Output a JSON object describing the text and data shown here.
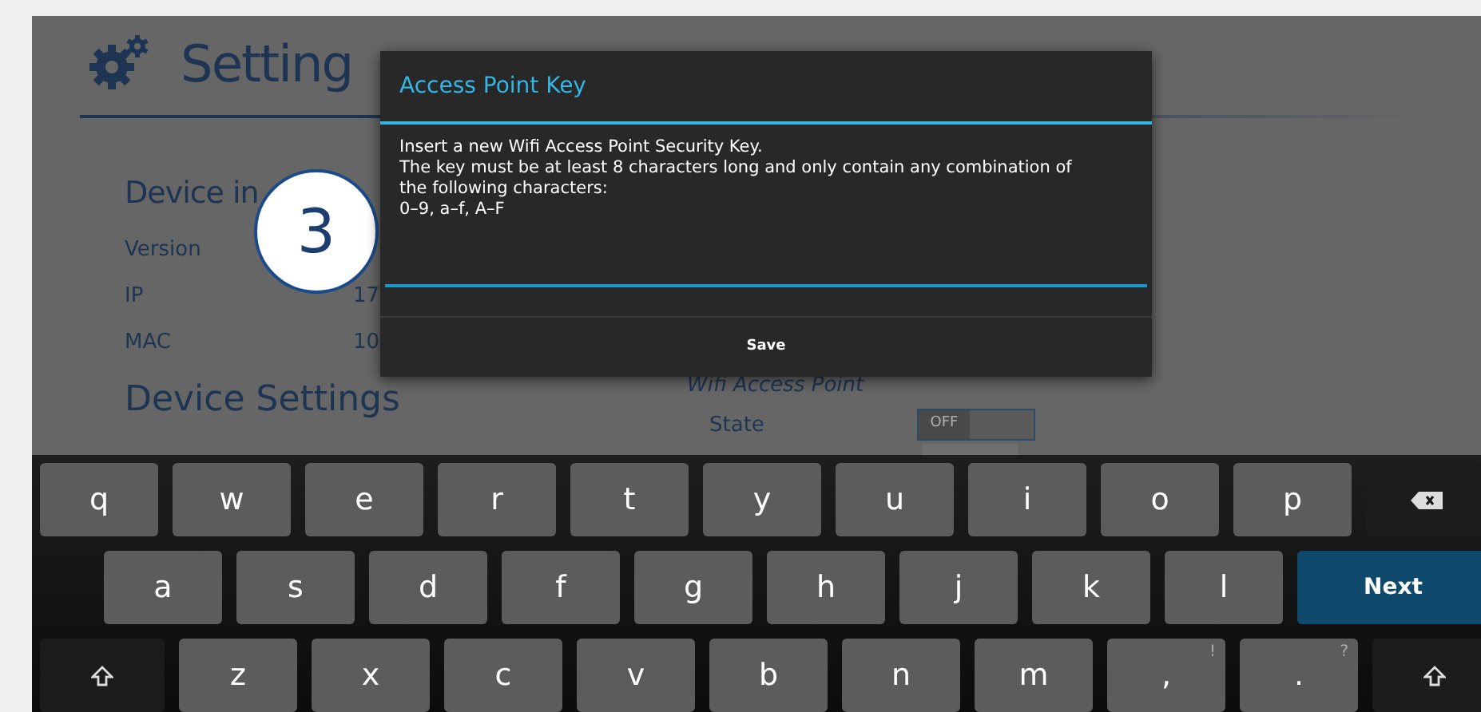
{
  "page": {
    "title": "Setting",
    "info_heading": "Device in",
    "info_rows": [
      {
        "label": "Version"
      },
      {
        "label": "IP",
        "value": "17"
      },
      {
        "label": "MAC",
        "value": "10"
      }
    ],
    "settings_heading": "Device Settings",
    "wifi_heading": "Wifi Access Point",
    "state_label": "State",
    "state_toggle": {
      "label": "OFF",
      "on": false
    }
  },
  "callout": "3",
  "dialog": {
    "title": "Access Point Key",
    "lines": [
      "Insert a new Wifi Access Point Security Key.",
      "The key must be at least 8 characters long and only contain any combination of",
      "the following characters:",
      "0–9, a–f, A–F"
    ],
    "button": "Save"
  },
  "keyboard": {
    "rows": [
      [
        {
          "kind": "char",
          "label": "q"
        },
        {
          "kind": "char",
          "label": "w"
        },
        {
          "kind": "char",
          "label": "e"
        },
        {
          "kind": "char",
          "label": "r"
        },
        {
          "kind": "char",
          "label": "t"
        },
        {
          "kind": "char",
          "label": "y"
        },
        {
          "kind": "char",
          "label": "u"
        },
        {
          "kind": "char",
          "label": "i"
        },
        {
          "kind": "char",
          "label": "o"
        },
        {
          "kind": "char",
          "label": "p"
        },
        {
          "kind": "backspace"
        }
      ],
      [
        {
          "kind": "char",
          "label": "a"
        },
        {
          "kind": "char",
          "label": "s"
        },
        {
          "kind": "char",
          "label": "d"
        },
        {
          "kind": "char",
          "label": "f"
        },
        {
          "kind": "char",
          "label": "g"
        },
        {
          "kind": "char",
          "label": "h"
        },
        {
          "kind": "char",
          "label": "j"
        },
        {
          "kind": "char",
          "label": "k"
        },
        {
          "kind": "char",
          "label": "l"
        },
        {
          "kind": "action",
          "label": "Next"
        }
      ],
      [
        {
          "kind": "shift"
        },
        {
          "kind": "char",
          "label": "z"
        },
        {
          "kind": "char",
          "label": "x"
        },
        {
          "kind": "char",
          "label": "c"
        },
        {
          "kind": "char",
          "label": "v"
        },
        {
          "kind": "char",
          "label": "b"
        },
        {
          "kind": "char",
          "label": "n"
        },
        {
          "kind": "char",
          "label": "m"
        },
        {
          "kind": "char",
          "label": ",",
          "alt": "!"
        },
        {
          "kind": "char",
          "label": ".",
          "alt": "?"
        },
        {
          "kind": "shift"
        }
      ]
    ]
  }
}
